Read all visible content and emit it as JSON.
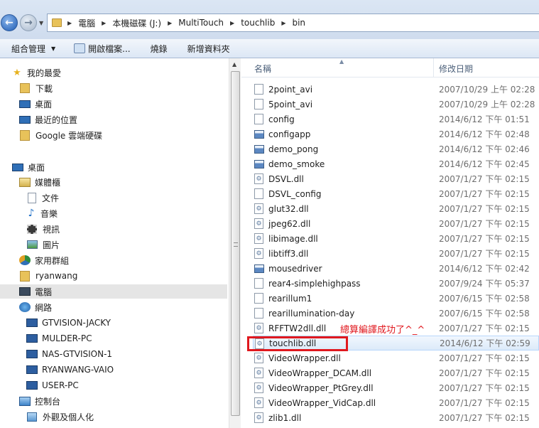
{
  "address": {
    "crumbs": [
      "電腦",
      "本機磁碟 (J:)",
      "MultiTouch",
      "touchlib",
      "bin"
    ]
  },
  "toolbar": {
    "organize": "組合管理",
    "open": "開啟檔案...",
    "burn": "燒錄",
    "new_folder": "新增資料夾"
  },
  "nav": {
    "favorites": "我的最愛",
    "downloads": "下載",
    "desktop_fav": "桌面",
    "recent": "最近的位置",
    "google_drive": "Google 雲端硬碟",
    "desktop": "桌面",
    "libraries": "媒體櫃",
    "documents": "文件",
    "music": "音樂",
    "videos": "視訊",
    "pictures": "圖片",
    "homegroup": "家用群組",
    "user": "ryanwang",
    "computer": "電腦",
    "network": "網路",
    "hosts": [
      "GTVISION-JACKY",
      "MULDER-PC",
      "NAS-GTVISION-1",
      "RYANWANG-VAIO",
      "USER-PC"
    ],
    "control_panel": "控制台",
    "appearance": "外觀及個人化"
  },
  "columns": {
    "name": "名稱",
    "date": "修改日期"
  },
  "files": [
    {
      "name": "2point_avi",
      "date": "2007/10/29 上午 02:28",
      "type": "doc"
    },
    {
      "name": "5point_avi",
      "date": "2007/10/29 上午 02:28",
      "type": "doc"
    },
    {
      "name": "config",
      "date": "2014/6/12 下午 01:51",
      "type": "doc"
    },
    {
      "name": "configapp",
      "date": "2014/6/12 下午 02:48",
      "type": "app"
    },
    {
      "name": "demo_pong",
      "date": "2014/6/12 下午 02:46",
      "type": "app"
    },
    {
      "name": "demo_smoke",
      "date": "2014/6/12 下午 02:45",
      "type": "app"
    },
    {
      "name": "DSVL.dll",
      "date": "2007/1/27 下午 02:15",
      "type": "dll"
    },
    {
      "name": "DSVL_config",
      "date": "2007/1/27 下午 02:15",
      "type": "doc"
    },
    {
      "name": "glut32.dll",
      "date": "2007/1/27 下午 02:15",
      "type": "dll"
    },
    {
      "name": "jpeg62.dll",
      "date": "2007/1/27 下午 02:15",
      "type": "dll"
    },
    {
      "name": "libimage.dll",
      "date": "2007/1/27 下午 02:15",
      "type": "dll"
    },
    {
      "name": "libtiff3.dll",
      "date": "2007/1/27 下午 02:15",
      "type": "dll"
    },
    {
      "name": "mousedriver",
      "date": "2014/6/12 下午 02:42",
      "type": "app"
    },
    {
      "name": "rear4-simplehighpass",
      "date": "2007/9/24 下午 05:37",
      "type": "doc"
    },
    {
      "name": "rearillum1",
      "date": "2007/6/15 下午 02:58",
      "type": "doc"
    },
    {
      "name": "rearillumination-day",
      "date": "2007/6/15 下午 02:58",
      "type": "doc"
    },
    {
      "name": "RFFTW2dll.dll",
      "date": "2007/1/27 下午 02:15",
      "type": "dll"
    },
    {
      "name": "touchlib.dll",
      "date": "2014/6/12 下午 02:59",
      "type": "dll"
    },
    {
      "name": "VideoWrapper.dll",
      "date": "2007/1/27 下午 02:15",
      "type": "dll"
    },
    {
      "name": "VideoWrapper_DCAM.dll",
      "date": "2007/1/27 下午 02:15",
      "type": "dll"
    },
    {
      "name": "VideoWrapper_PtGrey.dll",
      "date": "2007/1/27 下午 02:15",
      "type": "dll"
    },
    {
      "name": "VideoWrapper_VidCap.dll",
      "date": "2007/1/27 下午 02:15",
      "type": "dll"
    },
    {
      "name": "zlib1.dll",
      "date": "2007/1/27 下午 02:15",
      "type": "dll"
    }
  ],
  "selected_file": "touchlib.dll",
  "annotation": "總算編譯成功了^_^",
  "colors": {
    "annotation": "#e0181e",
    "selection": "#dceaf9"
  }
}
